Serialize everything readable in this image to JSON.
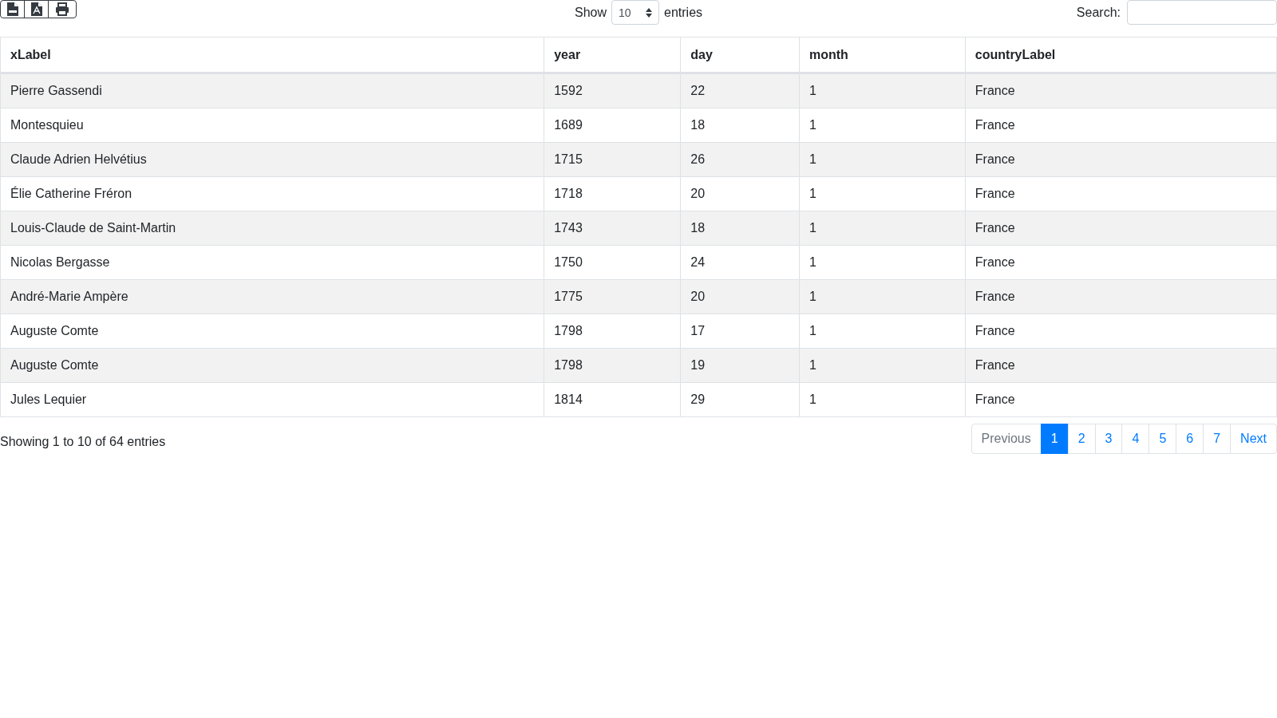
{
  "export_buttons": [
    {
      "kind": "csv"
    },
    {
      "kind": "pdf"
    },
    {
      "kind": "print"
    }
  ],
  "length_control": {
    "label_before": "Show",
    "value": "10",
    "label_after": "entries"
  },
  "search": {
    "label": "Search:"
  },
  "table": {
    "columns": [
      "xLabel",
      "year",
      "day",
      "month",
      "countryLabel"
    ],
    "rows": [
      [
        "Pierre Gassendi",
        "1592",
        "22",
        "1",
        "France"
      ],
      [
        "Montesquieu",
        "1689",
        "18",
        "1",
        "France"
      ],
      [
        "Claude Adrien Helvétius",
        "1715",
        "26",
        "1",
        "France"
      ],
      [
        "Élie Catherine Fréron",
        "1718",
        "20",
        "1",
        "France"
      ],
      [
        "Louis-Claude de Saint-Martin",
        "1743",
        "18",
        "1",
        "France"
      ],
      [
        "Nicolas Bergasse",
        "1750",
        "24",
        "1",
        "France"
      ],
      [
        "André-Marie Ampère",
        "1775",
        "20",
        "1",
        "France"
      ],
      [
        "Auguste Comte",
        "1798",
        "17",
        "1",
        "France"
      ],
      [
        "Auguste Comte",
        "1798",
        "19",
        "1",
        "France"
      ],
      [
        "Jules Lequier",
        "1814",
        "29",
        "1",
        "France"
      ]
    ]
  },
  "info": "Showing 1 to 10 of 64 entries",
  "pagination": [
    {
      "label": "Previous",
      "selected": false,
      "disabled": true
    },
    {
      "label": "1",
      "selected": true,
      "disabled": false
    },
    {
      "label": "2",
      "selected": false,
      "disabled": false
    },
    {
      "label": "3",
      "selected": false,
      "disabled": false
    },
    {
      "label": "4",
      "selected": false,
      "disabled": false
    },
    {
      "label": "5",
      "selected": false,
      "disabled": false
    },
    {
      "label": "6",
      "selected": false,
      "disabled": false
    },
    {
      "label": "7",
      "selected": false,
      "disabled": false
    },
    {
      "label": "Next",
      "selected": false,
      "disabled": false
    }
  ]
}
